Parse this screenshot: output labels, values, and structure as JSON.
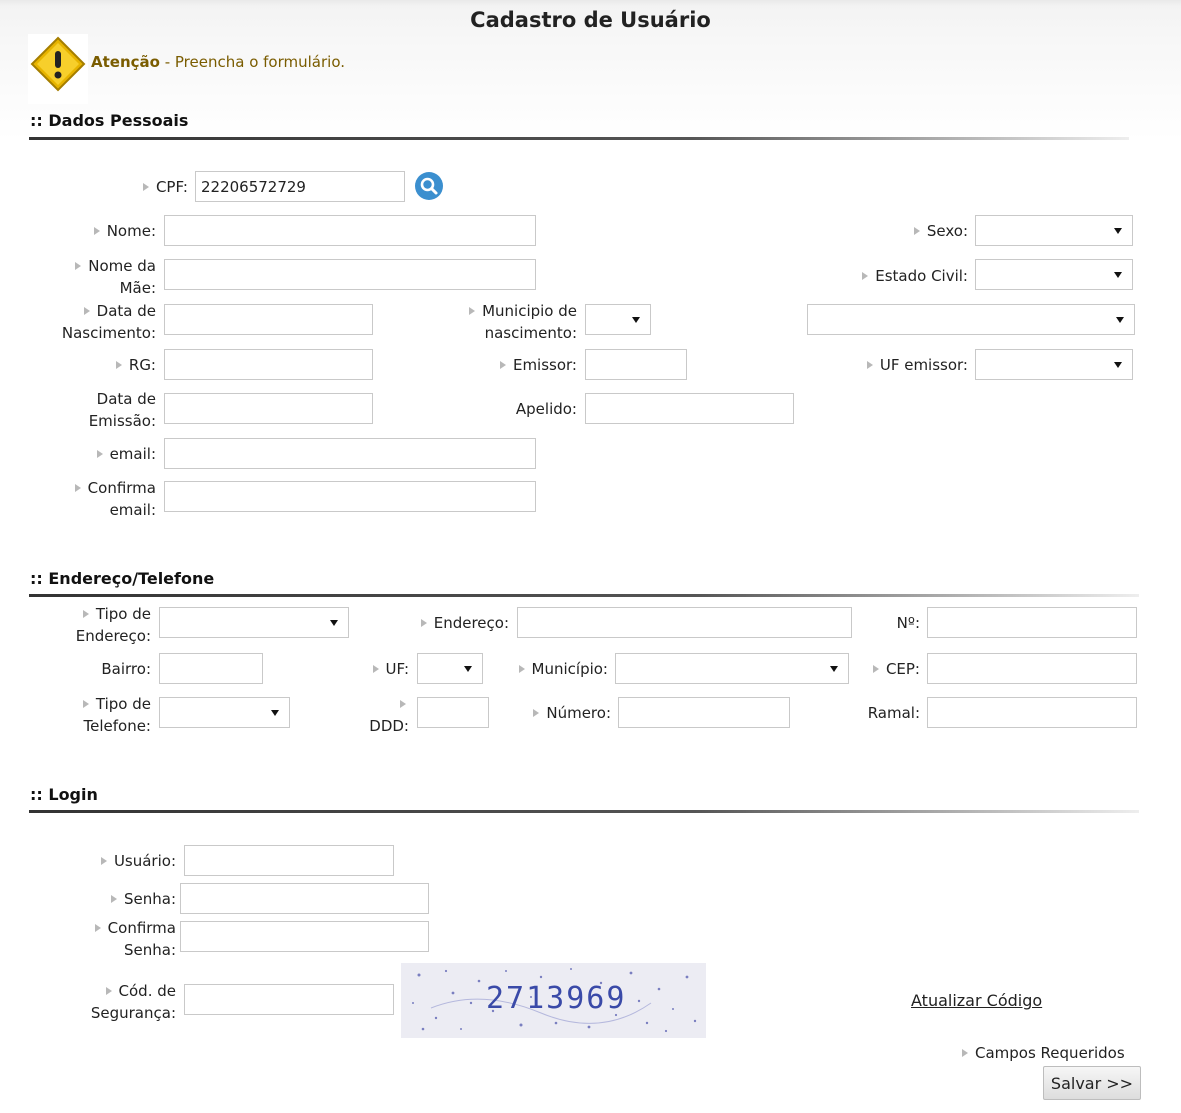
{
  "title": "Cadastro de Usuário",
  "alert": {
    "strong": "Atenção",
    "message": " - Preencha o formulário."
  },
  "sections": {
    "personal": ":: Dados Pessoais",
    "address": ":: Endereço/Telefone",
    "login": ":: Login"
  },
  "personal": {
    "cpf_label": "CPF:",
    "cpf_value": "22206572729",
    "nome_label": "Nome:",
    "mae_label_1": "Nome da",
    "mae_label_2": "Mãe:",
    "sexo_label": "Sexo:",
    "estado_civil_label": "Estado Civil:",
    "nasc_label_1": "Data de",
    "nasc_label_2": "Nascimento:",
    "municipio_nasc_label_1": "Municipio de",
    "municipio_nasc_label_2": "nascimento:",
    "rg_label": "RG:",
    "emissor_label": "Emissor:",
    "uf_emissor_label": "UF emissor:",
    "emissao_label_1": "Data de",
    "emissao_label_2": "Emissão:",
    "apelido_label": "Apelido:",
    "email_label": "email:",
    "confirma_email_label_1": "Confirma",
    "confirma_email_label_2": "email:"
  },
  "address": {
    "tipo_end_label_1": "Tipo de",
    "tipo_end_label_2": "Endereço:",
    "endereco_label": "Endereço:",
    "numero_label": "Nº:",
    "bairro_label": "Bairro:",
    "uf_label": "UF:",
    "municipio_label": "Município:",
    "cep_label": "CEP:",
    "tipo_tel_label_1": "Tipo de",
    "tipo_tel_label_2": "Telefone:",
    "ddd_label": "DDD:",
    "telefone_label": "Número:",
    "ramal_label": "Ramal:"
  },
  "login": {
    "usuario_label": "Usuário:",
    "senha_label": "Senha:",
    "confirma_senha_label_1": "Confirma",
    "confirma_senha_label_2": "Senha:",
    "codigo_label_1": "Cód. de",
    "codigo_label_2": "Segurança:",
    "captcha_text": "2713969",
    "refresh_link": "Atualizar Código"
  },
  "footer": {
    "required_note": "Campos Requeridos",
    "save_label": "Salvar >>"
  },
  "colors": {
    "accent": "#3b8fcf",
    "warning": "#f2c200",
    "alert_text": "#7a5c00",
    "captcha_text": "#3a4aa8"
  },
  "icons": {
    "warning": "warning-diamond-icon",
    "search": "search-icon",
    "bullet": "triangle-bullet-icon"
  }
}
